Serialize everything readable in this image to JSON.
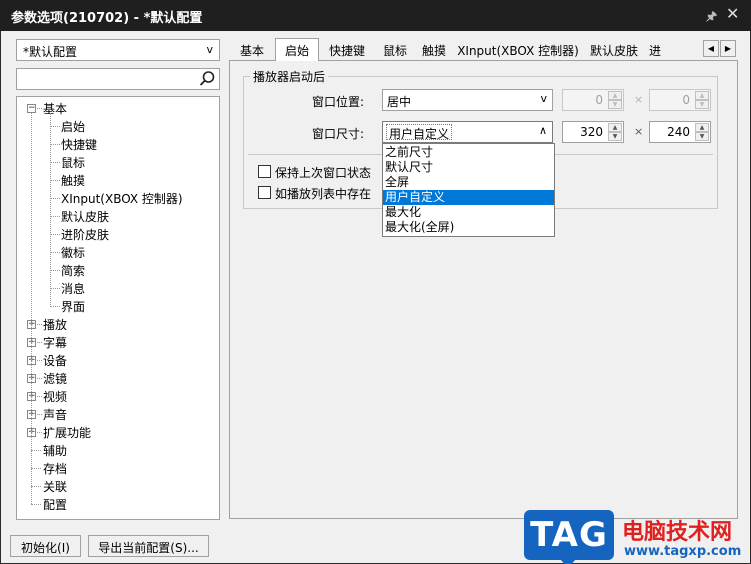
{
  "window": {
    "title": "参数选项(210702) - *默认配置",
    "pin_icon": "pin-icon",
    "close_icon": "close-icon"
  },
  "profile": {
    "selected": "*默认配置",
    "arrow": "v"
  },
  "search": {
    "placeholder": "",
    "value": ""
  },
  "tree": {
    "groups": [
      {
        "label": "基本",
        "expanded": true,
        "expander": "−",
        "children": [
          "启始",
          "快捷键",
          "鼠标",
          "触摸",
          "XInput(XBOX 控制器)",
          "默认皮肤",
          "进阶皮肤",
          "徽标",
          "简索",
          "消息",
          "界面"
        ]
      },
      {
        "label": "播放",
        "expander": "+"
      },
      {
        "label": "字幕",
        "expander": "+"
      },
      {
        "label": "设备",
        "expander": "+"
      },
      {
        "label": "滤镜",
        "expander": "+"
      },
      {
        "label": "视频",
        "expander": "+"
      },
      {
        "label": "声音",
        "expander": "+"
      },
      {
        "label": "扩展功能",
        "expander": "+"
      },
      {
        "label": "辅助"
      },
      {
        "label": "存档"
      },
      {
        "label": "关联"
      },
      {
        "label": "配置"
      }
    ]
  },
  "tabs": {
    "items": [
      "基本",
      "启始",
      "快捷键",
      "鼠标",
      "触摸",
      "XInput(XBOX 控制器)",
      "默认皮肤",
      "进"
    ],
    "active_index": 1,
    "scroll_left": "◀",
    "scroll_right": "▶"
  },
  "startup": {
    "group_title": "播放器启动后",
    "position_label": "窗口位置:",
    "position_value": "居中",
    "position_x": "0",
    "position_y": "0",
    "size_label": "窗口尺寸:",
    "size_value": "用户自定义",
    "size_arrow": "∧",
    "size_w": "320",
    "size_h": "240",
    "times": "×",
    "spin_up": "▲",
    "spin_down": "▼",
    "dropdown_options": [
      "之前尺寸",
      "默认尺寸",
      "全屏",
      "用户自定义",
      "最大化",
      "最大化(全屏)"
    ],
    "dropdown_selected_index": 3,
    "checkbox_1": "保持上次窗口状态",
    "checkbox_2": "如播放列表中存在"
  },
  "buttons": {
    "init": "初始化(I)",
    "export": "导出当前配置(S)..."
  },
  "watermark": {
    "tag": "TAG",
    "site": "电脑技术网",
    "url": "www.tagxp.com"
  },
  "colors": {
    "titlebar": "#1f1f1f",
    "selection": "#0078d7",
    "watermark_blue": "#1565c0",
    "watermark_red": "#e02020"
  }
}
